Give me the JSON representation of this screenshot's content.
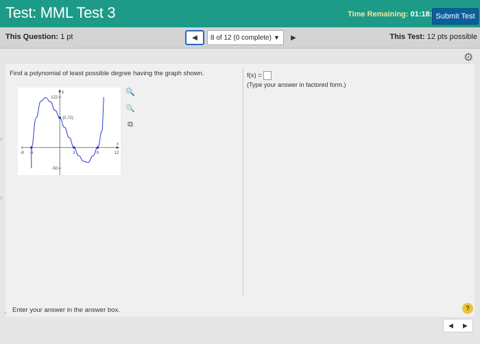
{
  "header": {
    "title_prefix": "Test:",
    "title_name": "MML Test 3",
    "time_label": "Time Remaining:",
    "time_value": "01:18:26",
    "submit_label": "Submit Test"
  },
  "question_bar": {
    "this_question_label": "This Question:",
    "this_question_value": "1 pt",
    "selector_text": "8 of 12 (0 complete)",
    "this_test_label": "This Test:",
    "this_test_value": "12 pts possible"
  },
  "icons": {
    "gear": "gear-icon",
    "prev": "arrow-left-icon",
    "next": "arrow-right-icon",
    "dropdown": "chevron-down-icon",
    "zoom_in": "zoom-in-icon",
    "zoom_out": "zoom-out-icon",
    "popout": "popout-icon",
    "help": "help-icon"
  },
  "question": {
    "prompt": "Find a polynomial of least possible degree having the graph shown.",
    "answer_prefix": "f(x) =",
    "answer_value": "",
    "hint": "(Type your answer in factored form.)",
    "footer": "Enter your answer in the answer box.",
    "help_symbol": "?"
  },
  "graph": {
    "y_axis_label": "y",
    "x_axis_label": "x",
    "top_tick": "122",
    "bottom_tick": "-50",
    "point_label": "(0,72)",
    "x_ticks": [
      "-8",
      "-6",
      "3",
      "8",
      "12"
    ]
  },
  "chart_data": {
    "type": "line",
    "x": [
      -6,
      -5,
      -4,
      -3,
      -2,
      -1,
      0,
      1,
      2,
      3,
      4,
      5,
      6,
      7,
      8,
      9
    ],
    "y": [
      0,
      72,
      112,
      121,
      111,
      90,
      72,
      49,
      24,
      0,
      -20,
      -33,
      -36,
      -20,
      0,
      42
    ],
    "marked_points": [
      [
        -6,
        0
      ],
      [
        0,
        72
      ],
      [
        3,
        0
      ],
      [
        8,
        0
      ]
    ],
    "xlim": [
      -8,
      12
    ],
    "ylim": [
      -50,
      122
    ]
  }
}
